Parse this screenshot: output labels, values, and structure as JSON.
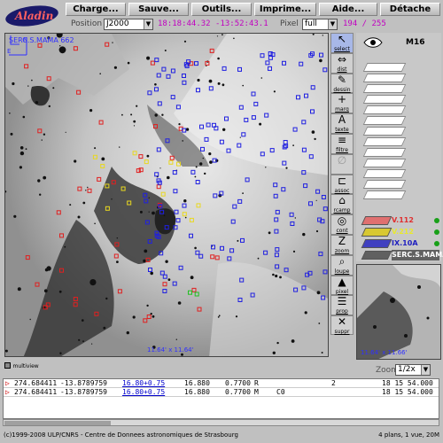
{
  "menu": {
    "items": [
      "Charge...",
      "Sauve...",
      "Outils...",
      "Imprime...",
      "Aide...",
      "Détache"
    ]
  },
  "position_bar": {
    "position_label": "Position",
    "frame": "J2000",
    "coords": "18:18:44.32 -13:52:43.1",
    "pixel_label": "Pixel",
    "pixel_mode": "full",
    "pixel_value": "194 / 255"
  },
  "view": {
    "survey_label": "SERC.S.MAMA 662",
    "scale_label": "11.64' x 11.64'",
    "north_label": "N",
    "east_label": "E"
  },
  "tools": [
    {
      "icon": "cursor-icon",
      "label": "select",
      "active": true
    },
    {
      "icon": "distance-icon",
      "label": "dist"
    },
    {
      "icon": "draw-icon",
      "label": "dessin"
    },
    {
      "icon": "marker-icon",
      "label": "marq"
    },
    {
      "icon": "text-icon",
      "label": "texte"
    },
    {
      "icon": "filter-icon",
      "label": "filtre"
    },
    {
      "icon": "disabled-icon",
      "label": "",
      "disabled": true
    },
    {
      "icon": "assoc-icon",
      "label": "assoc"
    },
    {
      "icon": "rcamp-icon",
      "label": "rcamp"
    },
    {
      "icon": "contour-icon",
      "label": "cont"
    },
    {
      "icon": "zoom-icon",
      "label": "zoom"
    },
    {
      "icon": "loupe-icon",
      "label": "loupe"
    },
    {
      "icon": "pixel-icon",
      "label": "pixel"
    },
    {
      "icon": "prop-icon",
      "label": "prop"
    },
    {
      "icon": "delete-icon",
      "label": "suppr"
    }
  ],
  "stack": {
    "title": "M16",
    "layers": [
      {
        "name": "V.112",
        "color": "#e03030",
        "swatch": "#e07070"
      },
      {
        "name": "V.212",
        "color": "#e8e830",
        "swatch": "#d8c830"
      },
      {
        "name": "IX.10A",
        "color": "#2020c0",
        "swatch": "#4040c0"
      },
      {
        "name": "SERC.S.MAMA",
        "color": "#ffffff",
        "swatch": "#606060"
      }
    ]
  },
  "zoom_panel": {
    "label": "11.64' x 11.66'",
    "zoom_label": "Zoom",
    "zoom_value": "1/2x"
  },
  "status_top": "multiview",
  "table_rows": [
    {
      "ra": "274.684411",
      "dec": "-13.8789759",
      "link": "16.80+0.75",
      "mag": "16.880",
      "err": "0.7700",
      "flag": "R",
      "extra": "",
      "num": "2",
      "time": "18 15 54.000"
    },
    {
      "ra": "274.684411",
      "dec": "-13.8789759",
      "link": "16.80+0.75",
      "mag": "16.880",
      "err": "0.7700",
      "flag": "M",
      "extra": "C0",
      "num": "",
      "time": "18 15 54.000"
    }
  ],
  "footer": {
    "copyright": "(c)1999-2008 ULP/CNRS - Centre de Donnees astronomiques de Strasbourg",
    "summary": "4 plans, 1 vue, 20M"
  }
}
